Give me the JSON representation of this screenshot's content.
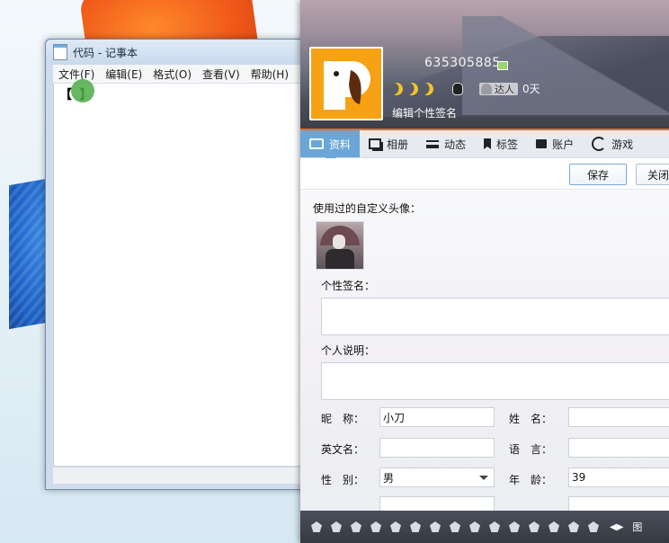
{
  "notepad": {
    "title": "代码 - 记事本",
    "menu": [
      "文件(F)",
      "编辑(E)",
      "格式(O)",
      "查看(V)",
      "帮助(H)"
    ],
    "content": "【 】"
  },
  "qq": {
    "number": "635305885",
    "badge_label": "达人",
    "days": "0天",
    "signature_placeholder": "编辑个性签名",
    "tabs": [
      {
        "label": "资料",
        "icon": "id-card-icon",
        "active": true
      },
      {
        "label": "相册",
        "icon": "album-icon"
      },
      {
        "label": "动态",
        "icon": "feed-list-icon"
      },
      {
        "label": "标签",
        "icon": "bookmark-icon"
      },
      {
        "label": "账户",
        "icon": "wallet-icon"
      },
      {
        "label": "游戏",
        "icon": "game-icon"
      }
    ],
    "save_label": "保存",
    "close_label": "关闭",
    "used_avatar_label": "使用过的自定义头像：",
    "personal_signature_label": "个性签名：",
    "personal_desc_label": "个人说明：",
    "fields": {
      "nickname_label": "昵　称：",
      "nickname_value": "小刀",
      "surname_label": "姓　名：",
      "english_name_label": "英文名：",
      "language_label": "语　言：",
      "gender_label": "性　别：",
      "gender_value": "男",
      "age_label": "年　龄：",
      "age_value": "39"
    },
    "bottom_text": "图",
    "colors": {
      "accent_tab": "#6aa6d8",
      "header_line": "#f06d1c",
      "avatar_bg": "#f7a114"
    }
  }
}
